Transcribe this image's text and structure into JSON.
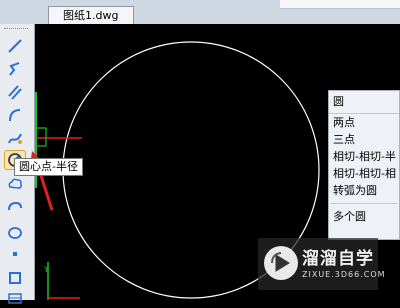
{
  "document": {
    "tab_title": "图纸1.dwg"
  },
  "toolbar": {
    "tools": [
      {
        "icon": "line-icon"
      },
      {
        "icon": "polyline-icon"
      },
      {
        "icon": "double-line-icon"
      },
      {
        "icon": "arc-icon"
      },
      {
        "icon": "spline-icon"
      },
      {
        "icon": "circle-icon",
        "active": true
      },
      {
        "icon": "revision-cloud-icon"
      },
      {
        "icon": "ellipse-arc-icon"
      },
      {
        "icon": "point-icon"
      },
      {
        "icon": "rectangle-icon"
      },
      {
        "icon": "table-icon"
      }
    ]
  },
  "tooltip": {
    "text": "圆心点-半径"
  },
  "circle_menu": {
    "title": "圆",
    "items": [
      "两点",
      "三点",
      "相切-相切-半",
      "相切-相切-相",
      "转弧为圆"
    ],
    "extra_item": "多个圆"
  },
  "watermark": {
    "main": "溜溜自学",
    "sub": "ZIXUE.3D66.COM"
  },
  "colors": {
    "canvas": "#000000",
    "circle": "#ffffff",
    "arrow": "#e02020",
    "ucs_y": "#22c022",
    "ucs_x": "#e02020"
  }
}
